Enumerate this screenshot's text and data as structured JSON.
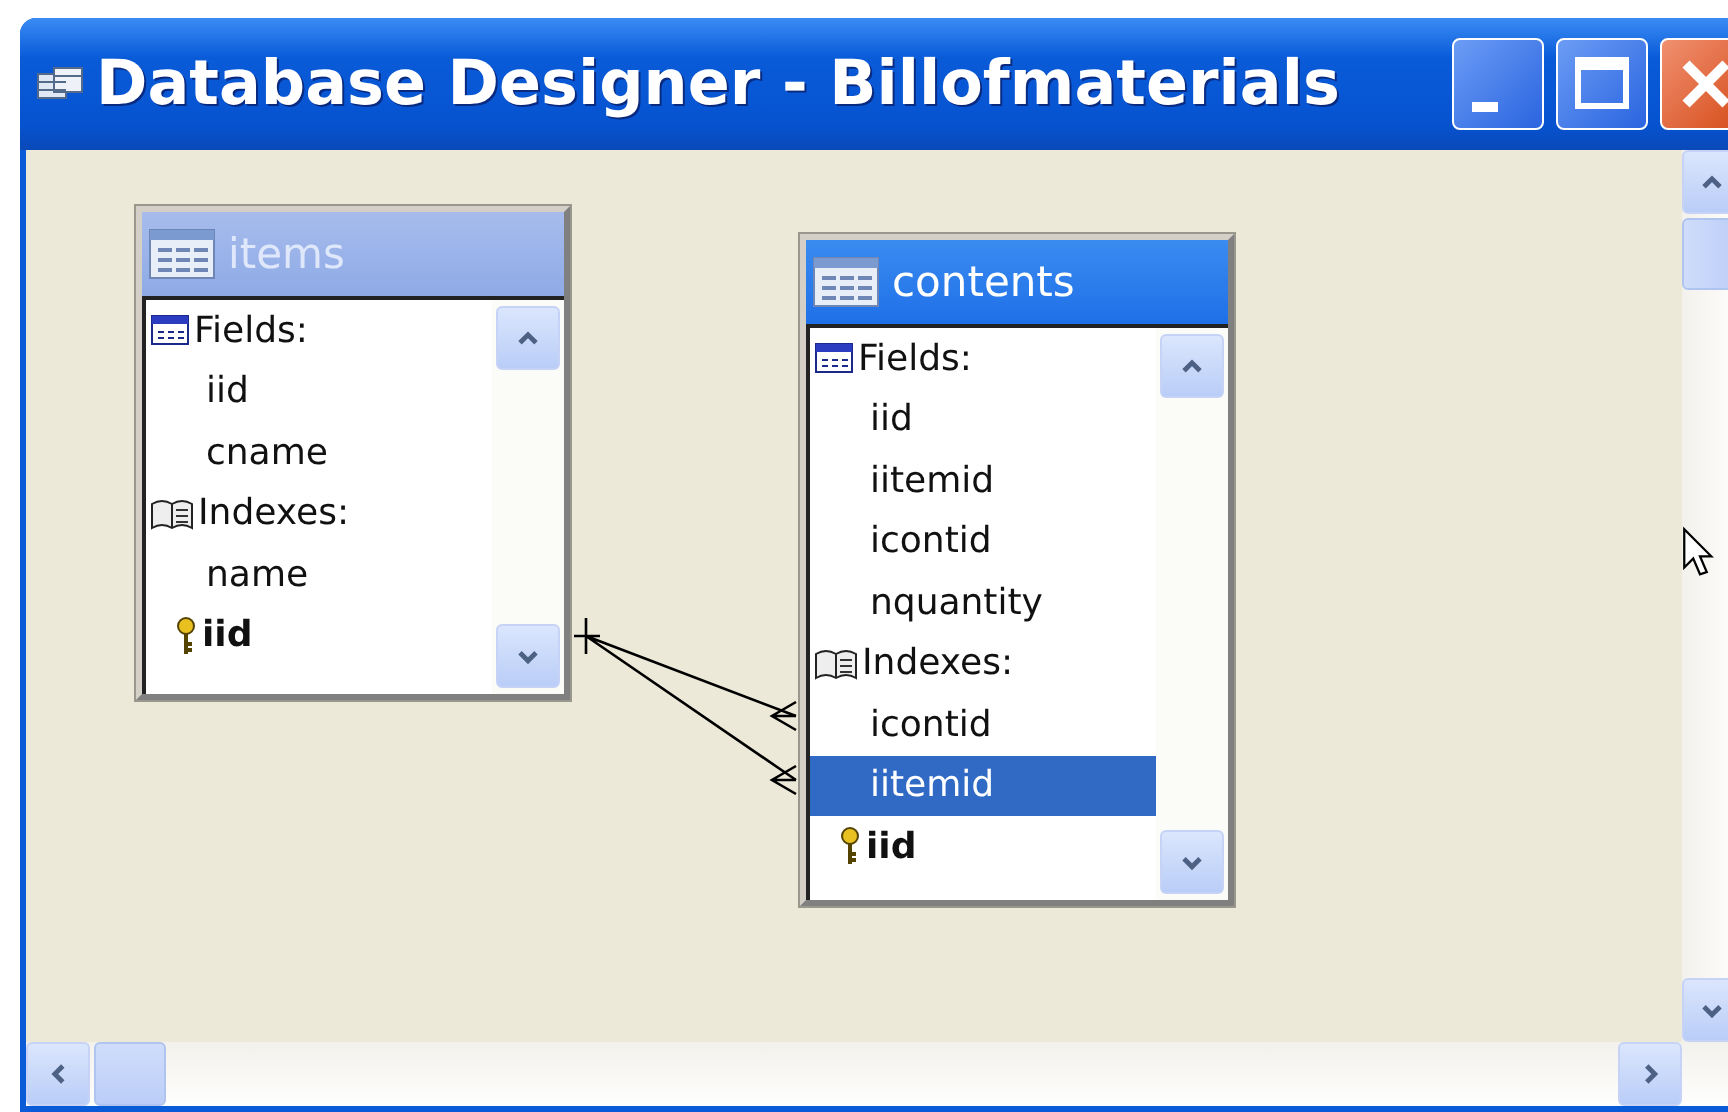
{
  "window": {
    "title": "Database Designer - Billofmaterials"
  },
  "tables": [
    {
      "name": "items",
      "active": false,
      "rows": [
        {
          "kind": "fields_heading",
          "text": "Fields:",
          "selected": false
        },
        {
          "kind": "item",
          "text": "iid",
          "selected": false
        },
        {
          "kind": "item",
          "text": "cname",
          "selected": false
        },
        {
          "kind": "indexes_heading",
          "text": "Indexes:",
          "selected": false
        },
        {
          "kind": "item",
          "text": "name",
          "selected": false
        },
        {
          "kind": "key",
          "text": "iid",
          "selected": false
        }
      ]
    },
    {
      "name": "contents",
      "active": true,
      "rows": [
        {
          "kind": "fields_heading",
          "text": "Fields:",
          "selected": false
        },
        {
          "kind": "item",
          "text": "iid",
          "selected": false
        },
        {
          "kind": "item",
          "text": "iitemid",
          "selected": false
        },
        {
          "kind": "item",
          "text": "icontid",
          "selected": false
        },
        {
          "kind": "item",
          "text": "nquantity",
          "selected": false
        },
        {
          "kind": "indexes_heading",
          "text": "Indexes:",
          "selected": false
        },
        {
          "kind": "item",
          "text": "icontid",
          "selected": false
        },
        {
          "kind": "item",
          "text": "iitemid",
          "selected": true
        },
        {
          "kind": "key",
          "text": "iid",
          "selected": false
        }
      ]
    }
  ]
}
